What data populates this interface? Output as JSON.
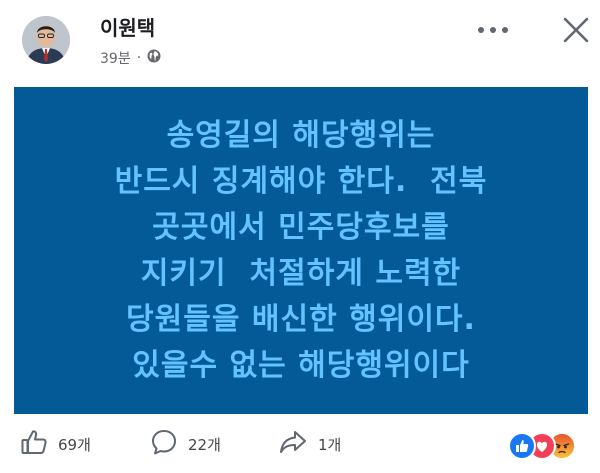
{
  "post": {
    "author": "이원택",
    "time": "39분",
    "separator": "·",
    "privacy_icon": "globe-icon"
  },
  "banner": {
    "background": "#045a96",
    "text_color": "#63c2ff",
    "lines": [
      "송영길의 해당행위는",
      "반드시 징계해야 한다.  전북",
      "곳곳에서 민주당후보를",
      "지키기  처절하게 노력한",
      "당원들을 배신한 행위이다.",
      "있을수 없는 해당행위이다"
    ]
  },
  "actions": {
    "like_count": "69개",
    "comment_count": "22개",
    "share_count": "1개"
  },
  "reactions": [
    "like-reaction-icon",
    "love-reaction-icon",
    "angry-reaction-icon"
  ]
}
